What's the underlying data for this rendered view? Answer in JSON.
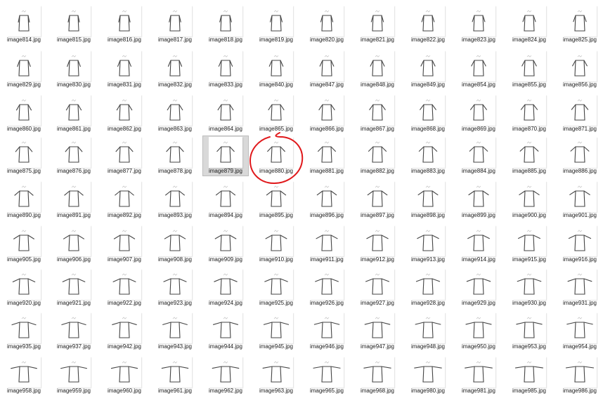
{
  "explorer": {
    "selected_file": "image879.jpg",
    "annotated_file": "image880.jpg",
    "annotation_color": "#e0191c",
    "rows": [
      [
        "image814.jpg",
        "image815.jpg",
        "image816.jpg",
        "image817.jpg",
        "image818.jpg",
        "image819.jpg",
        "image820.jpg",
        "image821.jpg",
        "image822.jpg",
        "image823.jpg",
        "image824.jpg",
        "image825.jpg"
      ],
      [
        "image829.jpg",
        "image830.jpg",
        "image831.jpg",
        "image832.jpg",
        "image833.jpg",
        "image840.jpg",
        "image847.jpg",
        "image848.jpg",
        "image849.jpg",
        "image854.jpg",
        "image855.jpg",
        "image856.jpg"
      ],
      [
        "image860.jpg",
        "image861.jpg",
        "image862.jpg",
        "image863.jpg",
        "image864.jpg",
        "image865.jpg",
        "image866.jpg",
        "image867.jpg",
        "image868.jpg",
        "image869.jpg",
        "image870.jpg",
        "image871.jpg"
      ],
      [
        "image875.jpg",
        "image876.jpg",
        "image877.jpg",
        "image878.jpg",
        "image879.jpg",
        "image880.jpg",
        "image881.jpg",
        "image882.jpg",
        "image883.jpg",
        "image884.jpg",
        "image885.jpg",
        "image886.jpg"
      ],
      [
        "image890.jpg",
        "image891.jpg",
        "image892.jpg",
        "image893.jpg",
        "image894.jpg",
        "image895.jpg",
        "image896.jpg",
        "image897.jpg",
        "image898.jpg",
        "image899.jpg",
        "image900.jpg",
        "image901.jpg"
      ],
      [
        "image905.jpg",
        "image906.jpg",
        "image907.jpg",
        "image908.jpg",
        "image909.jpg",
        "image910.jpg",
        "image911.jpg",
        "image912.jpg",
        "image913.jpg",
        "image914.jpg",
        "image915.jpg",
        "image916.jpg"
      ],
      [
        "image920.jpg",
        "image921.jpg",
        "image922.jpg",
        "image923.jpg",
        "image924.jpg",
        "image925.jpg",
        "image926.jpg",
        "image927.jpg",
        "image928.jpg",
        "image929.jpg",
        "image930.jpg",
        "image931.jpg"
      ],
      [
        "image935.jpg",
        "image937.jpg",
        "image942.jpg",
        "image943.jpg",
        "image944.jpg",
        "image945.jpg",
        "image946.jpg",
        "image947.jpg",
        "image948.jpg",
        "image950.jpg",
        "image953.jpg",
        "image954.jpg"
      ],
      [
        "image958.jpg",
        "image959.jpg",
        "image960.jpg",
        "image961.jpg",
        "image962.jpg",
        "image963.jpg",
        "image965.jpg",
        "image968.jpg",
        "image980.jpg",
        "image981.jpg",
        "image985.jpg",
        "image986.jpg"
      ]
    ]
  }
}
